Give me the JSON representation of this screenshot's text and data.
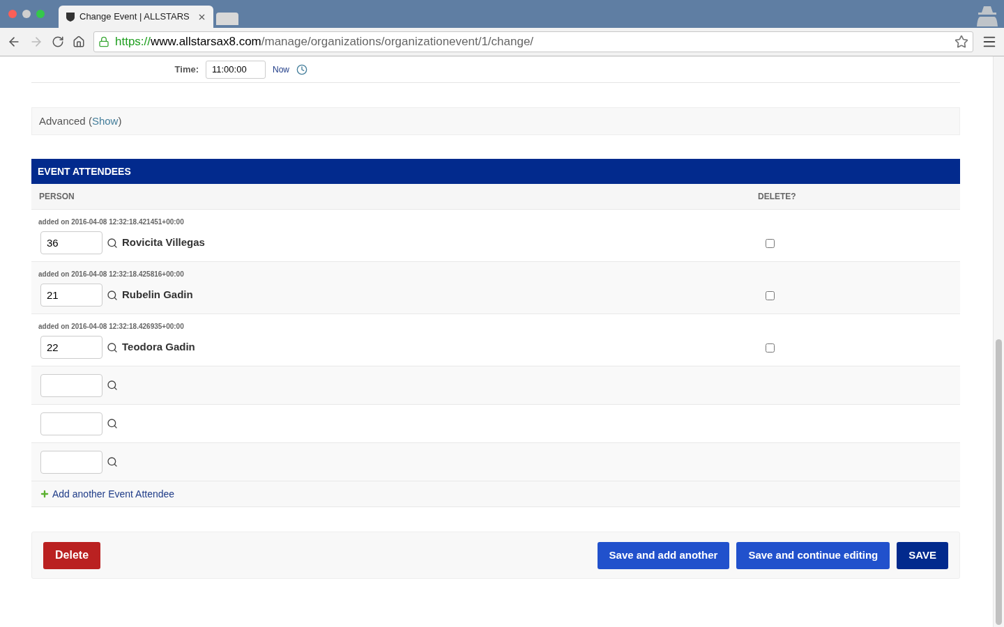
{
  "browser": {
    "tab": {
      "title": "Change Event | ALLSTARS",
      "selected": true
    },
    "url": {
      "scheme": "https://",
      "host": "www.allstarsax8.com",
      "path": "/manage/organizations/organizationevent/1/change/"
    }
  },
  "time_field": {
    "label": "Time:",
    "value": "11:00:00",
    "now_link": "Now"
  },
  "advanced": {
    "label": "Advanced (",
    "link": "Show",
    "close": ")"
  },
  "attendees": {
    "title": "EVENT ATTENDEES",
    "columns": [
      "PERSON",
      "DELETE?"
    ],
    "rows": [
      {
        "added": "added on 2016-04-08 12:32:18.421451+00:00",
        "id": "36",
        "name": "Rovicita Villegas",
        "delete": false
      },
      {
        "added": "added on 2016-04-08 12:32:18.425816+00:00",
        "id": "21",
        "name": "Rubelin Gadin",
        "delete": false
      },
      {
        "added": "added on 2016-04-08 12:32:18.426935+00:00",
        "id": "22",
        "name": "Teodora Gadin",
        "delete": false
      },
      {
        "id": ""
      },
      {
        "id": ""
      },
      {
        "id": ""
      }
    ],
    "add_link": "Add another Event Attendee"
  },
  "actions": {
    "delete": "Delete",
    "buttons": [
      {
        "label": "Save and add another",
        "kind": "secondary"
      },
      {
        "label": "Save and continue editing",
        "kind": "secondary"
      },
      {
        "label": "SAVE",
        "kind": "primary"
      }
    ]
  }
}
